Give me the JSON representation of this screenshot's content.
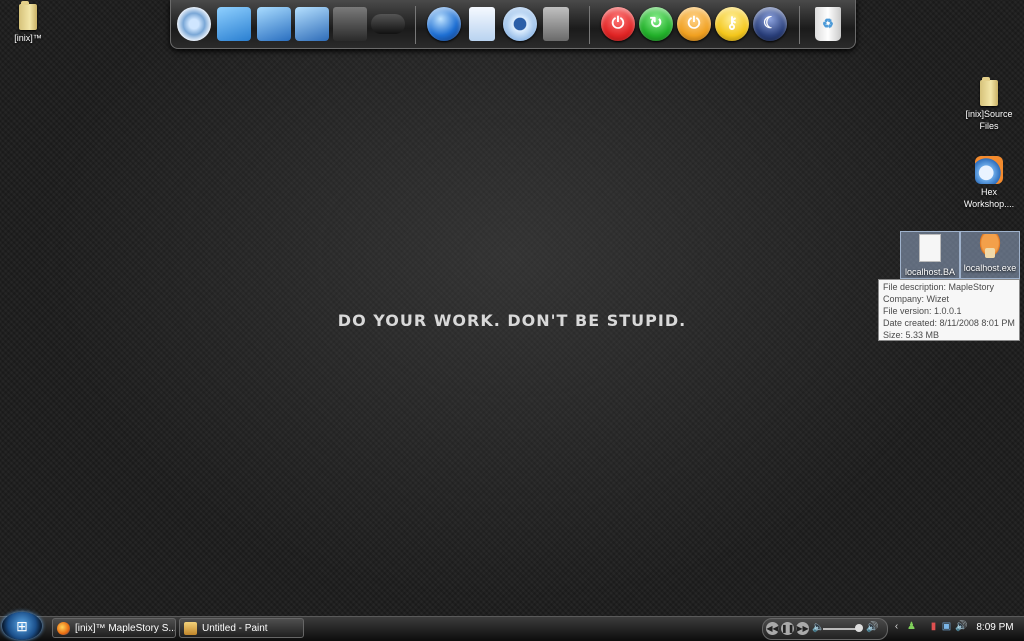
{
  "desktop": {
    "icons": [
      {
        "label": "[inix]™"
      },
      {
        "label": "[inix]Source Files"
      },
      {
        "label": "Hex Workshop...."
      },
      {
        "label": "localhost.BA"
      },
      {
        "label": "localhost.exe"
      }
    ],
    "motto": "DO YOUR WORK. DON'T BE STUPID."
  },
  "dock": {
    "icons": [
      "disc-drive-icon",
      "folder-icon",
      "folder-documents-icon",
      "folder-pictures-icon",
      "film-icon",
      "gamepad-icon",
      "browser-icon",
      "notepad-icon",
      "itunes-icon",
      "paint-brushes-icon",
      "power-off-icon",
      "restart-icon",
      "standby-icon",
      "key-icon",
      "moon-sleep-icon",
      "recycle-bin-icon"
    ],
    "colors": {
      "red": "#e02424",
      "green": "#22b02a",
      "orange": "#f0a020",
      "yellow": "#f3c61b",
      "blue": "#2a3f7a"
    }
  },
  "tooltip": {
    "lines": [
      "File description: MapleStory",
      "Company: Wizet",
      "File version: 1.0.0.1",
      "Date created: 8/11/2008 8:01 PM",
      "Size: 5.33 MB"
    ]
  },
  "taskbar": {
    "buttons": [
      {
        "label": "[inix]™ MapleStory S..."
      },
      {
        "label": "Untitled - Paint"
      }
    ],
    "clock": "8:09 PM"
  }
}
